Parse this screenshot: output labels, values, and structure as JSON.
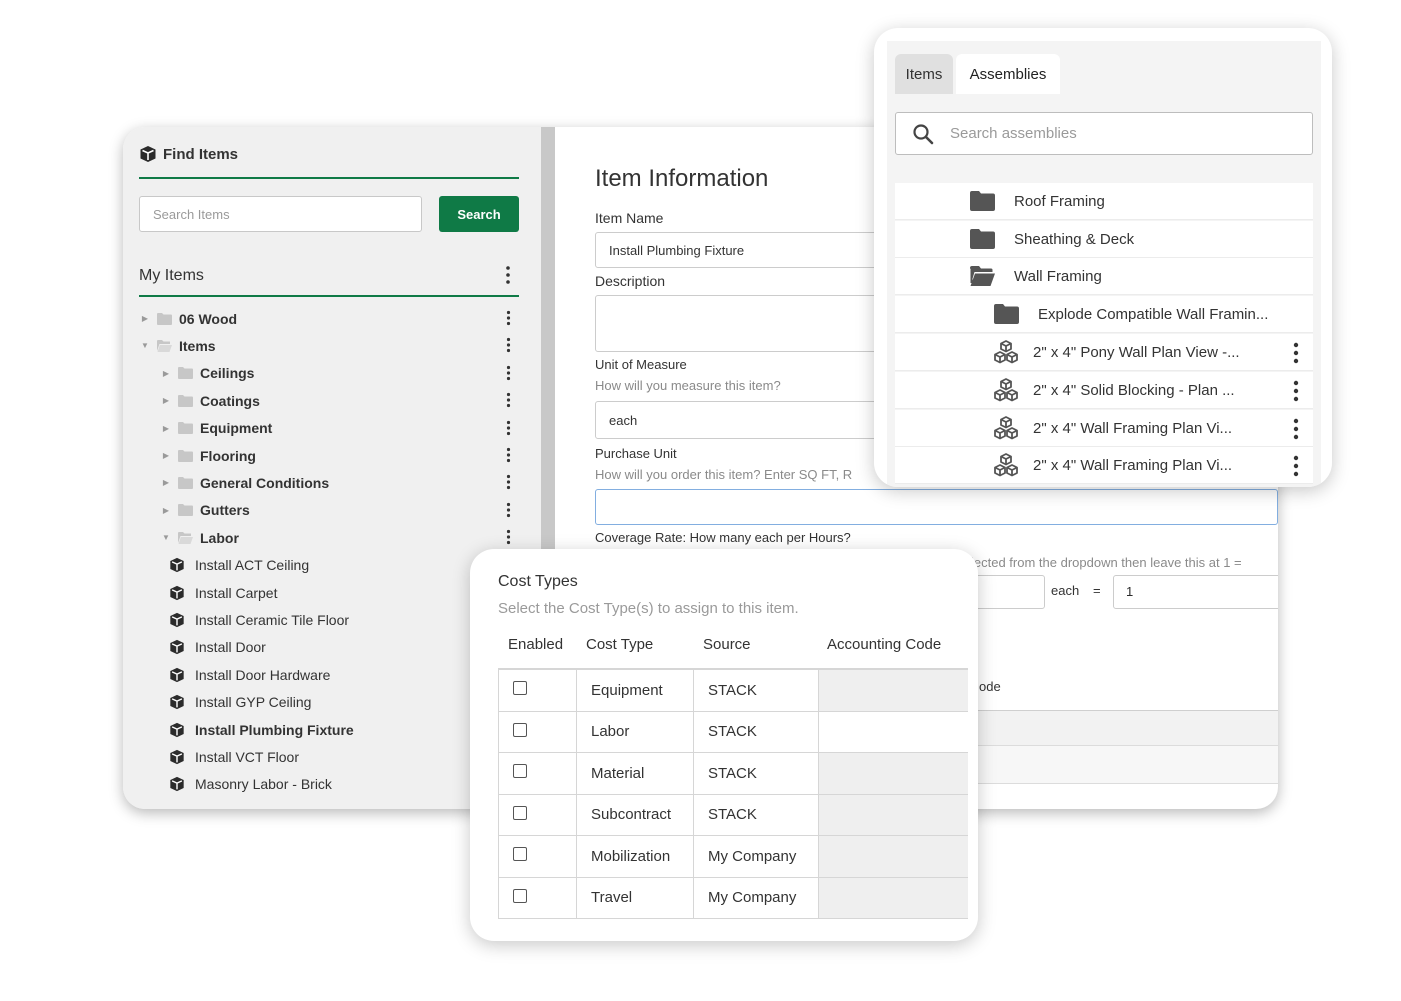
{
  "find_items": {
    "title": "Find Items",
    "search_placeholder": "Search Items",
    "search_button": "Search",
    "my_items_title": "My Items",
    "tree": [
      {
        "label": "06 Wood",
        "level": 0,
        "kind": "folder",
        "bold": true,
        "expanded": false
      },
      {
        "label": "Items",
        "level": 0,
        "kind": "folder",
        "bold": true,
        "expanded": true
      },
      {
        "label": "Ceilings",
        "level": 1,
        "kind": "folder",
        "bold": true,
        "expanded": false
      },
      {
        "label": "Coatings",
        "level": 1,
        "kind": "folder",
        "bold": true,
        "expanded": false
      },
      {
        "label": "Equipment",
        "level": 1,
        "kind": "folder",
        "bold": true,
        "expanded": false
      },
      {
        "label": "Flooring",
        "level": 1,
        "kind": "folder",
        "bold": true,
        "expanded": false
      },
      {
        "label": "General Conditions",
        "level": 1,
        "kind": "folder",
        "bold": true,
        "expanded": false
      },
      {
        "label": "Gutters",
        "level": 1,
        "kind": "folder",
        "bold": true,
        "expanded": false
      },
      {
        "label": "Labor",
        "level": 1,
        "kind": "folder",
        "bold": true,
        "expanded": true
      },
      {
        "label": "Install ACT Ceiling",
        "level": 2,
        "kind": "item",
        "bold": false
      },
      {
        "label": "Install Carpet",
        "level": 2,
        "kind": "item",
        "bold": false
      },
      {
        "label": "Install Ceramic Tile Floor",
        "level": 2,
        "kind": "item",
        "bold": false
      },
      {
        "label": "Install Door",
        "level": 2,
        "kind": "item",
        "bold": false
      },
      {
        "label": "Install Door Hardware",
        "level": 2,
        "kind": "item",
        "bold": false
      },
      {
        "label": "Install GYP Ceiling",
        "level": 2,
        "kind": "item",
        "bold": false
      },
      {
        "label": "Install Plumbing Fixture",
        "level": 2,
        "kind": "item",
        "bold": true
      },
      {
        "label": "Install VCT Floor",
        "level": 2,
        "kind": "item",
        "bold": false
      },
      {
        "label": "Masonry Labor - Brick",
        "level": 2,
        "kind": "item",
        "bold": false
      }
    ]
  },
  "item_info": {
    "title": "Item Information",
    "item_name_label": "Item Name",
    "item_name_value": "Install Plumbing Fixture",
    "description_label": "Description",
    "uom_label": "Unit of Measure",
    "uom_hint": "How will you measure this item?",
    "uom_value": "each",
    "purchase_label": "Purchase Unit",
    "purchase_hint": "How will you order this item? Enter SQ FT, R",
    "coverage_label": "Coverage Rate: How many each per Hours?",
    "coverage_hint_partial": "lected from the dropdown then leave this at 1 =",
    "coverage_unit": "each",
    "coverage_equals": "=",
    "coverage_value": "1",
    "code_partial": "ode"
  },
  "assemblies": {
    "tab_items": "Items",
    "tab_assemblies": "Assemblies",
    "search_placeholder": "Search assemblies",
    "rows": [
      {
        "label": "Roof Framing",
        "kind": "folder"
      },
      {
        "label": "Sheathing & Deck",
        "kind": "folder"
      },
      {
        "label": "Wall Framing",
        "kind": "folder-open"
      },
      {
        "label": "Explode Compatible Wall Framin...",
        "kind": "folder"
      },
      {
        "label": "2\" x 4\" Pony Wall Plan View -...",
        "kind": "assembly"
      },
      {
        "label": "2\" x 4\" Solid Blocking - Plan ...",
        "kind": "assembly"
      },
      {
        "label": "2\" x 4\" Wall Framing Plan Vi...",
        "kind": "assembly"
      },
      {
        "label": "2\" x 4\" Wall Framing Plan Vi...",
        "kind": "assembly"
      }
    ]
  },
  "cost_types": {
    "title": "Cost Types",
    "subtitle": "Select the Cost Type(s) to assign to this item.",
    "headers": {
      "enabled": "Enabled",
      "cost_type": "Cost Type",
      "source": "Source",
      "accounting_code": "Accounting Code"
    },
    "rows": [
      {
        "cost_type": "Equipment",
        "source": "STACK"
      },
      {
        "cost_type": "Labor",
        "source": "STACK"
      },
      {
        "cost_type": "Material",
        "source": "STACK"
      },
      {
        "cost_type": "Subcontract",
        "source": "STACK"
      },
      {
        "cost_type": "Mobilization",
        "source": "My Company"
      },
      {
        "cost_type": "Travel",
        "source": "My Company"
      }
    ]
  },
  "colors": {
    "brand_green": "#0f7a46",
    "focus_blue": "#82aee0"
  }
}
